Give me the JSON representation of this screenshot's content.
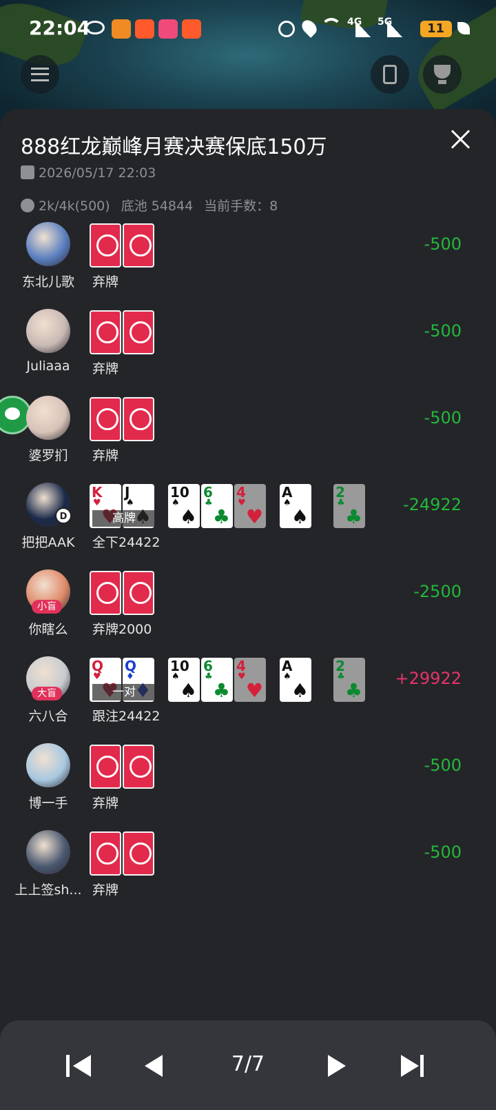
{
  "status_bar": {
    "time": "22:04",
    "battery": "11",
    "net1": "4G",
    "net2": "5G",
    "icons": [
      "eye-icon",
      "app-icon",
      "app-icon",
      "app-icon",
      "app-icon",
      "alarm-icon",
      "location-icon",
      "wifi-icon",
      "signal-icon",
      "leaf-icon"
    ]
  },
  "header": {
    "menu_icon": "menu-icon",
    "cards_icon": "cards-icon",
    "trophy_icon": "trophy-icon"
  },
  "panel": {
    "title": "888红龙巅峰月赛决赛保底150万",
    "datetime": "2026/05/17 22:03",
    "blinds": "2k/4k(500)",
    "pot": "底池 54844",
    "hand_count": "当前手数：8"
  },
  "players": [
    {
      "name": "东北儿歌",
      "action": "弃牌",
      "result": "-500",
      "cards": "hidden"
    },
    {
      "name": "Juliaaa",
      "action": "弃牌",
      "result": "-500",
      "cards": "hidden"
    },
    {
      "name": "婆罗扪",
      "action": "弃牌",
      "result": "-500",
      "cards": "hidden"
    },
    {
      "name": "把把AAK",
      "action": "全下24422",
      "result": "-24922",
      "hand_label": "高牌",
      "badge": "D",
      "hole": [
        {
          "rank": "K",
          "suit": "♥",
          "color": "red"
        },
        {
          "rank": "J",
          "suit": "♠",
          "color": "blk"
        }
      ]
    },
    {
      "name": "你瞎么",
      "action": "弃牌2000",
      "result": "-2500",
      "blind": "小盲",
      "cards": "hidden"
    },
    {
      "name": "六八合",
      "action": "跟注24422",
      "result": "+29922",
      "hand_label": "一对",
      "blind": "大盲",
      "hole": [
        {
          "rank": "Q",
          "suit": "♥",
          "color": "red"
        },
        {
          "rank": "Q",
          "suit": "♦",
          "color": "blu"
        }
      ]
    },
    {
      "name": "博一手",
      "action": "弃牌",
      "result": "-500",
      "cards": "hidden"
    },
    {
      "name": "上上签sh...",
      "action": "弃牌",
      "result": "-500",
      "cards": "hidden"
    }
  ],
  "board": [
    {
      "rank": "10",
      "suit": "♠",
      "color": "blk"
    },
    {
      "rank": "6",
      "suit": "♣",
      "color": "grn"
    },
    {
      "rank": "4",
      "suit": "♥",
      "color": "red"
    },
    {
      "rank": "A",
      "suit": "♠",
      "color": "blk"
    },
    {
      "rank": "2",
      "suit": "♣",
      "color": "grn"
    }
  ],
  "nav": {
    "page": "7/7",
    "first_icon": "skip-first-icon",
    "prev_icon": "prev-icon",
    "next_icon": "next-icon",
    "last_icon": "skip-last-icon"
  },
  "colors": {
    "loss": "#22b83a",
    "win": "#e6336a",
    "card_back": "#e22a4c",
    "panel": "#242529"
  }
}
